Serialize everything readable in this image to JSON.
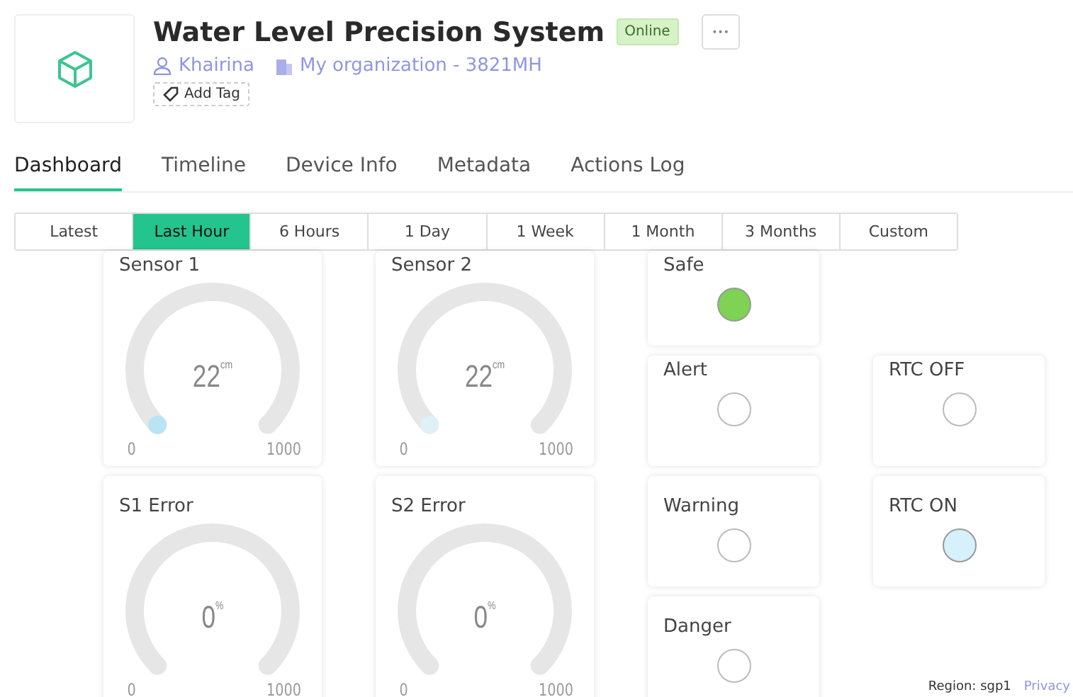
{
  "device": {
    "title": "Water Level Precision System",
    "status": "Online",
    "owner": "Khairina",
    "organization": "My organization - 3821MH",
    "add_tag": "Add Tag",
    "more": "•••"
  },
  "tabs": [
    {
      "label": "Dashboard",
      "selected": true
    },
    {
      "label": "Timeline",
      "selected": false
    },
    {
      "label": "Device Info",
      "selected": false
    },
    {
      "label": "Metadata",
      "selected": false
    },
    {
      "label": "Actions Log",
      "selected": false
    }
  ],
  "ranges": [
    {
      "label": "Latest",
      "selected": false
    },
    {
      "label": "Last Hour",
      "selected": true
    },
    {
      "label": "6 Hours",
      "selected": false
    },
    {
      "label": "1 Day",
      "selected": false
    },
    {
      "label": "1 Week",
      "selected": false
    },
    {
      "label": "1 Month",
      "selected": false
    },
    {
      "label": "3 Months",
      "selected": false
    },
    {
      "label": "Custom",
      "selected": false
    }
  ],
  "widgets": [
    {
      "kind": "gauge",
      "title": "Sensor 1",
      "value": "22",
      "unit": "cm",
      "min": "0",
      "max": "1000",
      "color": "#b8e4f5"
    },
    {
      "kind": "gauge",
      "title": "Sensor 2",
      "value": "22",
      "unit": "cm",
      "min": "0",
      "max": "1000",
      "color": "#dff1f6"
    },
    {
      "kind": "led",
      "title": "Safe",
      "on": true,
      "color": "#7ed254"
    },
    {
      "kind": "led",
      "title": "Alert",
      "on": false
    },
    {
      "kind": "led",
      "title": "RTC OFF",
      "on": false
    },
    {
      "kind": "gauge",
      "title": "S1 Error",
      "value": "0",
      "unit": "%",
      "min": "0",
      "max": "1000"
    },
    {
      "kind": "gauge",
      "title": "S2 Error",
      "value": "0",
      "unit": "%",
      "min": "0",
      "max": "1000"
    },
    {
      "kind": "led",
      "title": "Warning",
      "on": false
    },
    {
      "kind": "led",
      "title": "RTC ON",
      "on": true,
      "color": "#d6f1fb"
    },
    {
      "kind": "led",
      "title": "Danger",
      "on": false
    }
  ],
  "footer": {
    "region": "Region: sgp1",
    "privacy": "Privacy"
  }
}
